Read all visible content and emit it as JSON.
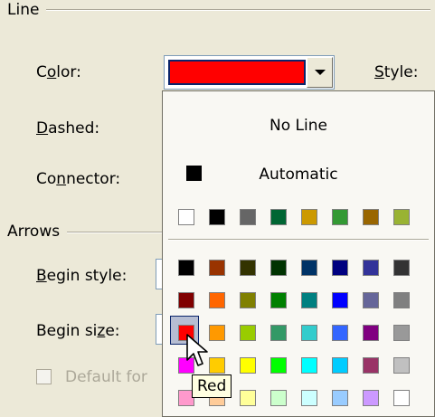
{
  "line_section": {
    "title": "Line",
    "color_label": "Color:",
    "style_label": "Style:",
    "dashed_label": "Dashed:",
    "connector_label": "Connector:",
    "selected_color": "#ff0000"
  },
  "arrows_section": {
    "title": "Arrows",
    "begin_style_label": "Begin style:",
    "begin_size_label": "Begin size:",
    "default_for_label": "Default for"
  },
  "palette": {
    "no_line_label": "No Line",
    "automatic_label": "Automatic",
    "automatic_color": "#000000",
    "recent_colors": [
      "#ffffff",
      "#000000",
      "#666666",
      "#006633",
      "#cc9900",
      "#339933",
      "#996600",
      "#99b333"
    ],
    "grid_rows": [
      [
        "#000000",
        "#993300",
        "#333300",
        "#003300",
        "#003366",
        "#000080",
        "#333399",
        "#333333"
      ],
      [
        "#800000",
        "#ff6600",
        "#808000",
        "#008000",
        "#008080",
        "#0000ff",
        "#666699",
        "#808080"
      ],
      [
        "#ff0000",
        "#ff9900",
        "#99cc00",
        "#339966",
        "#33cccc",
        "#3366ff",
        "#800080",
        "#999999"
      ],
      [
        "#ff00ff",
        "#ffcc00",
        "#ffff00",
        "#00ff00",
        "#00ffff",
        "#00ccff",
        "#993366",
        "#c0c0c0"
      ],
      [
        "#ff99cc",
        "#ffcc99",
        "#ffff99",
        "#ccffcc",
        "#ccffff",
        "#99ccff",
        "#cc99ff",
        "#ffffff"
      ]
    ],
    "hovered_tooltip": "Red"
  }
}
